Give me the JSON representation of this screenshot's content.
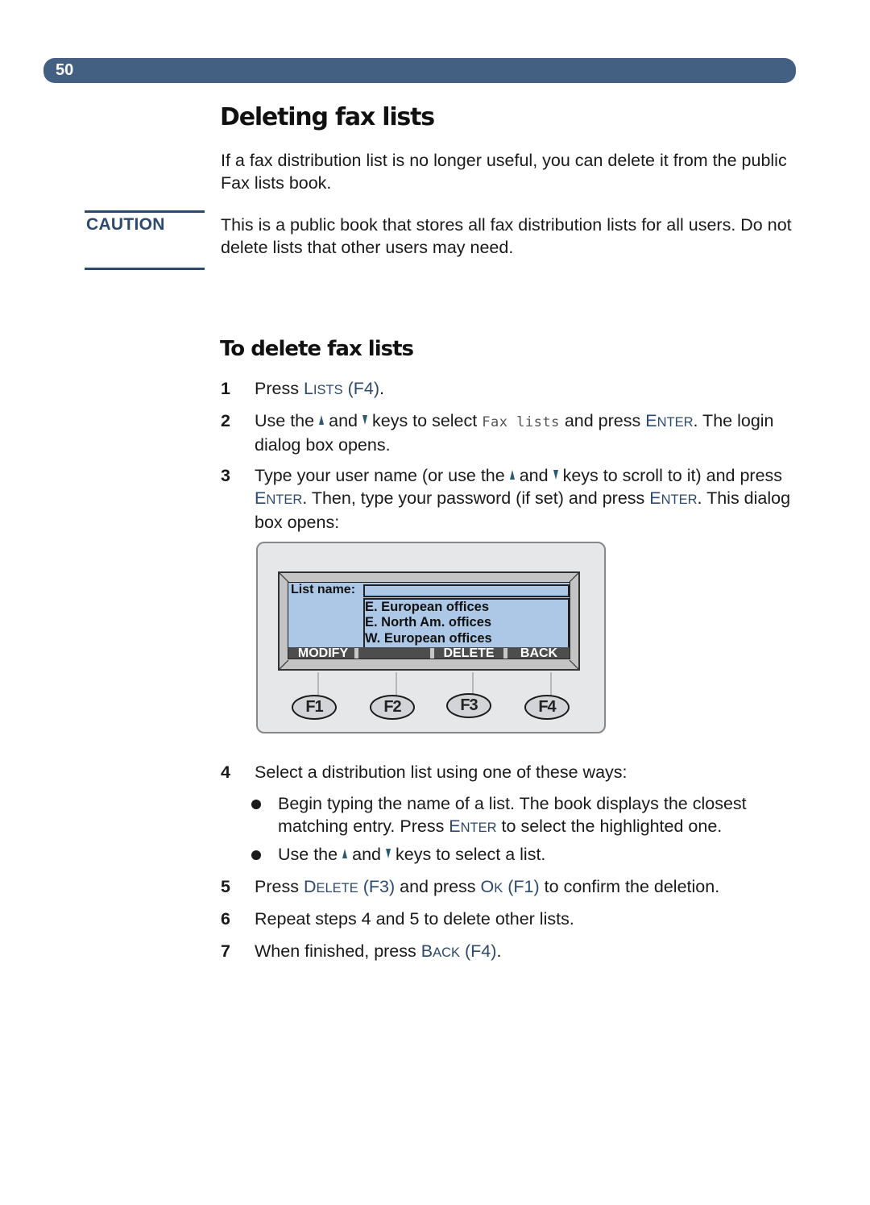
{
  "header": {
    "page_number": "50"
  },
  "title": "Deleting fax lists",
  "intro": "If a fax distribution list is no longer useful, you can delete it from the public Fax lists book.",
  "caution": {
    "label": "CAUTION",
    "text": "This is a public book that stores all fax distribution lists for all users. Do not delete lists that other users may need."
  },
  "procedure": {
    "heading": "To delete fax lists",
    "steps": [
      {
        "num": "1",
        "parts": {
          "a": "Press ",
          "key": "Lists",
          "b": " ",
          "fkey": "(F4)",
          "c": "."
        }
      },
      {
        "num": "2",
        "parts": {
          "a": "Use the",
          "and": "and",
          "b": "keys to select",
          "mono": "Fax lists",
          "c": "and press ",
          "key": "Enter",
          "d": ". The login dialog box opens."
        }
      },
      {
        "num": "3",
        "parts": {
          "a": "Type your user name (or use the",
          "and": "and",
          "b": "keys to scroll to it) and press ",
          "key1": "Enter",
          "c": ". Then, type your password (if set) and press ",
          "key2": "Enter",
          "d": ". This dialog box opens:"
        }
      },
      {
        "num": "4",
        "text": "Select a distribution list using one of these ways:"
      },
      {
        "num": "5",
        "parts": {
          "a": "Press ",
          "key1": "Delete",
          "fkey1": "(F3)",
          "b": " and press ",
          "key2": "Ok",
          "fkey2": "(F1)",
          "c": " to confirm the deletion."
        }
      },
      {
        "num": "6",
        "text": "Repeat steps 4 and 5 to delete other lists."
      },
      {
        "num": "7",
        "parts": {
          "a": "When finished, press ",
          "key": "Back",
          "fkey": "(F4)",
          "c": "."
        }
      }
    ],
    "sub_bullets": [
      {
        "a": "Begin typing the name of a list. The book displays the closest matching entry. Press ",
        "key": "Enter",
        "b": " to select the highlighted one."
      },
      {
        "a": "Use the",
        "and": "and",
        "b": "keys to select a list."
      }
    ]
  },
  "panel": {
    "field_label": "List name:",
    "field_value": "",
    "list_items": [
      "E. European offices",
      "E. North Am. offices",
      "W. European offices"
    ],
    "softkeys": [
      "MODIFY",
      "",
      "DELETE",
      "BACK"
    ],
    "function_keys": [
      "F1",
      "F2",
      "F3",
      "F4"
    ]
  },
  "colors": {
    "accent": "#435f82",
    "key_text": "#2c4a6e",
    "lcd": "#acc8e6"
  }
}
